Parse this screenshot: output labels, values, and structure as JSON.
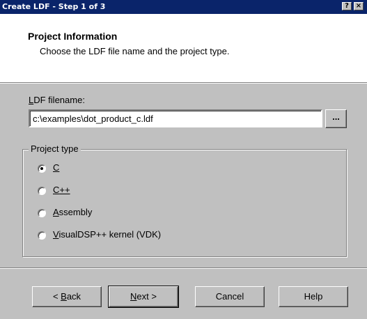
{
  "window": {
    "title": "Create LDF - Step 1 of 3",
    "help_glyph": "?",
    "close_glyph": "×"
  },
  "header": {
    "title": "Project Information",
    "subtitle": "Choose the LDF file name and the project type."
  },
  "ldf": {
    "label_accel": "L",
    "label_rest": "DF filename:",
    "value": "c:\\examples\\dot_product_c.ldf",
    "browse_label": "..."
  },
  "project_type": {
    "group_label": "Project type",
    "selected": "C",
    "options": [
      {
        "accel": "C",
        "rest": "",
        "checked": true
      },
      {
        "accel": "C",
        "rest": "++",
        "checked": false
      },
      {
        "accel": "A",
        "rest": "ssembly",
        "checked": false
      },
      {
        "accel": "V",
        "rest": "isualDSP++ kernel (VDK)",
        "checked": false
      }
    ]
  },
  "buttons": {
    "back": {
      "pre": "< ",
      "accel": "B",
      "rest": "ack"
    },
    "next": {
      "pre": "",
      "accel": "N",
      "rest": "ext >"
    },
    "cancel": "Cancel",
    "help": "Help"
  }
}
